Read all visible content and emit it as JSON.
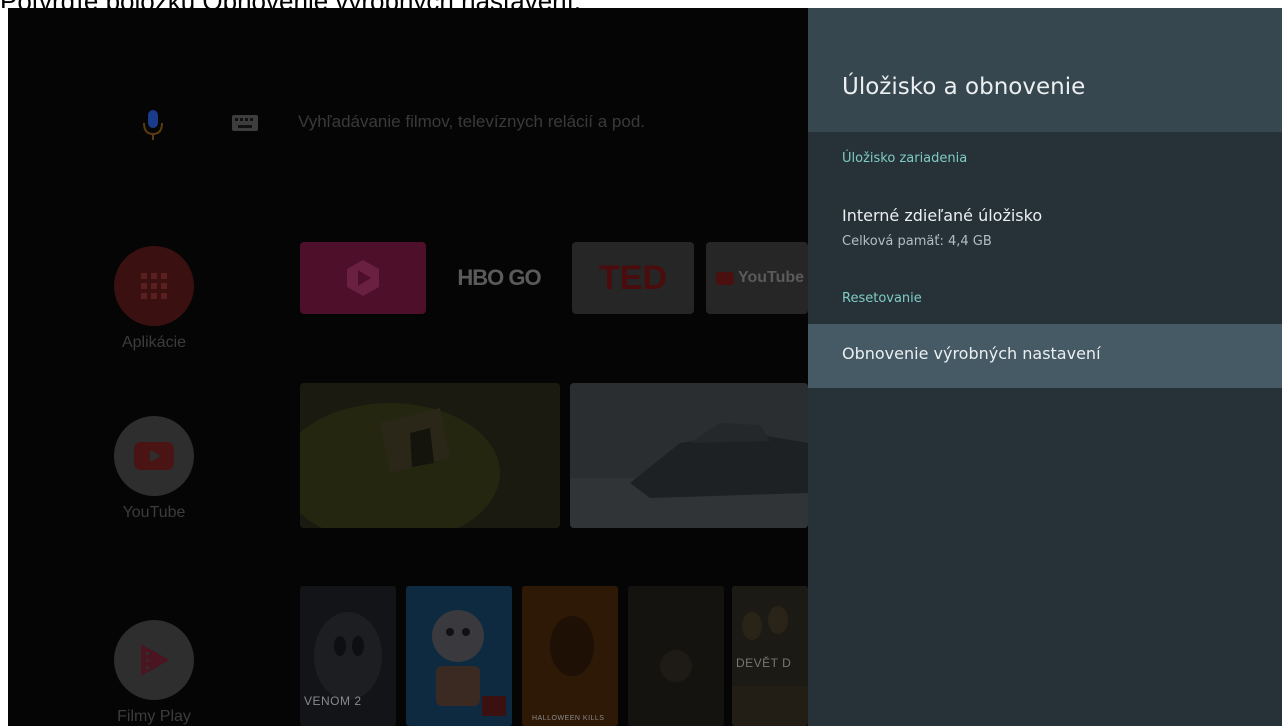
{
  "caption": "Potvrďte položku Obnovenie výrobných nastavení.",
  "launcher": {
    "search_placeholder": "Vyhľadávanie filmov, televíznych relácií a pod.",
    "side_items": [
      {
        "label": "Aplikácie",
        "icon": "apps-grid-icon",
        "color": "#c62828"
      },
      {
        "label": "YouTube",
        "icon": "youtube-icon",
        "color": "#e0e0e0"
      },
      {
        "label": "Filmy Play",
        "icon": "play-movies-icon",
        "color": "#e0e0e0"
      }
    ],
    "app_tiles": [
      {
        "label": "",
        "icon": "play-icon"
      },
      {
        "label": "HBO GO"
      },
      {
        "label": "TED"
      },
      {
        "label": "YouTube"
      }
    ],
    "posters": [
      {
        "label": "VENOM 2"
      },
      {
        "label": ""
      },
      {
        "label": "HALLOWEEN KILLS"
      },
      {
        "label": ""
      },
      {
        "label": "DEVĚT D"
      }
    ]
  },
  "panel": {
    "title": "Úložisko a obnovenie",
    "section_storage": "Úložisko zariadenia",
    "storage_item": {
      "title": "Interné zdieľané úložisko",
      "subtitle": "Celková pamäť: 4,4 GB"
    },
    "section_reset": "Resetovanie",
    "reset_item": {
      "title": "Obnovenie výrobných nastavení"
    }
  },
  "colors": {
    "panel_bg": "#263238",
    "panel_header": "#37474f",
    "selected_row": "#455a64",
    "section_accent": "#80cbc4"
  }
}
